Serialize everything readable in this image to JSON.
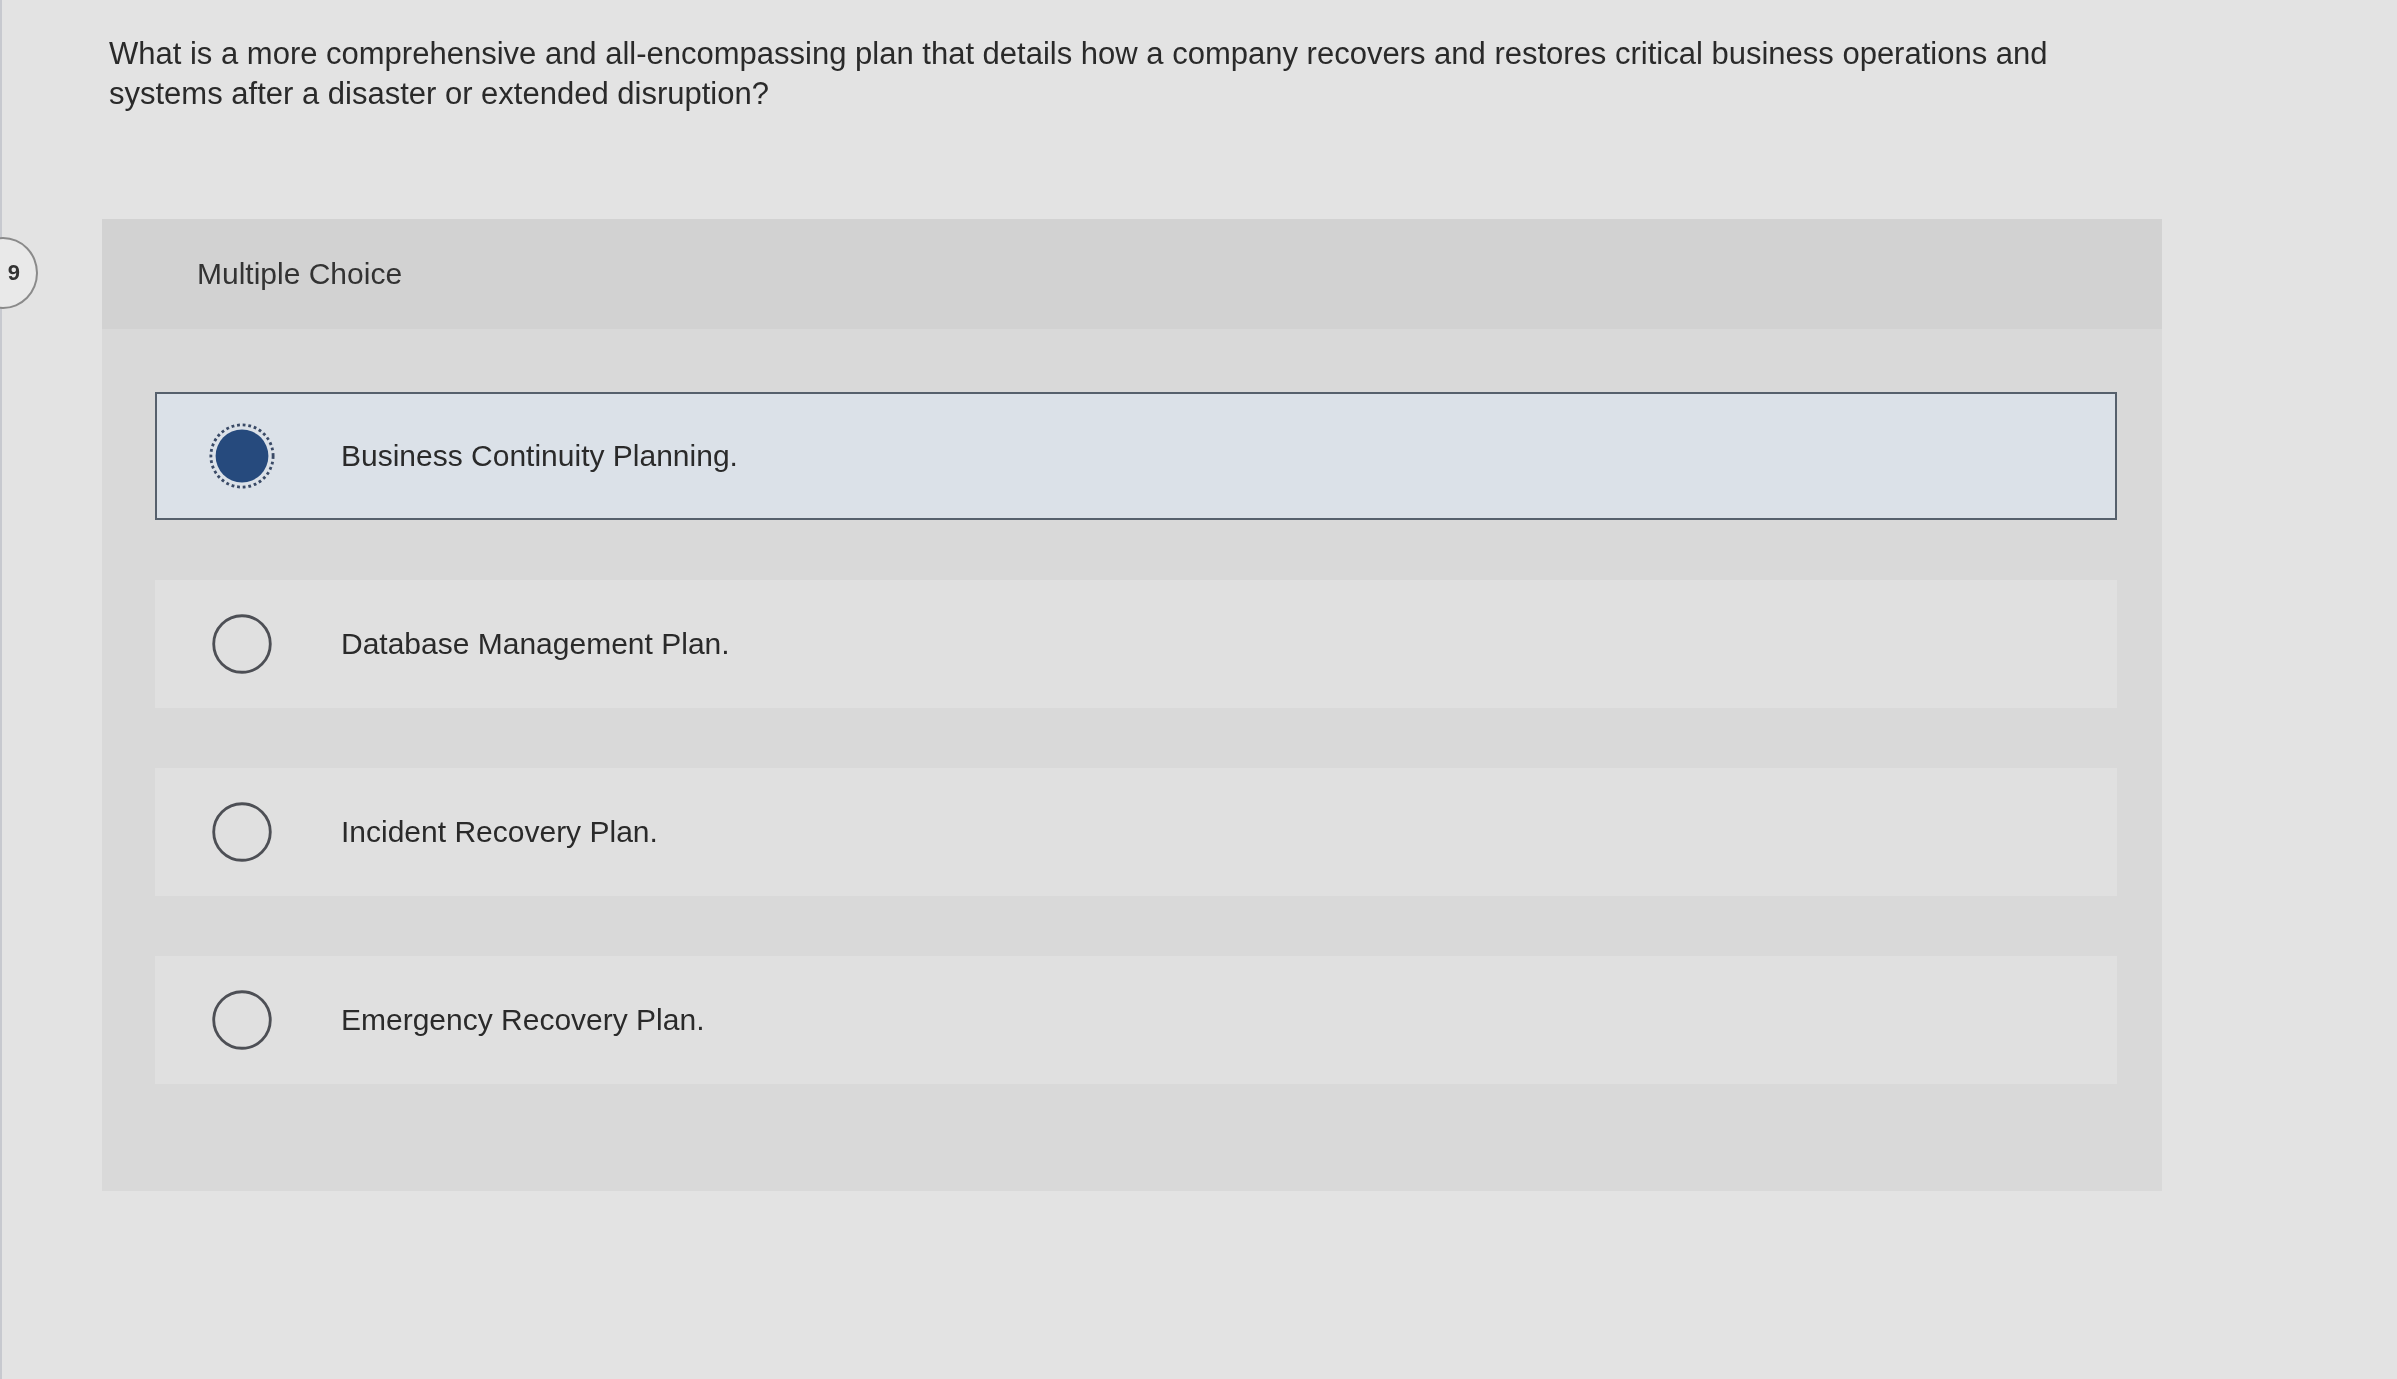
{
  "question_badge": {
    "number": "9"
  },
  "question": {
    "text": "What is a more comprehensive and all-encompassing plan that details how a company recovers and restores critical business operations and systems after a disaster or extended disruption?"
  },
  "answer_panel": {
    "title": "Multiple Choice",
    "options": [
      {
        "label": "Business Continuity Planning.",
        "selected": true
      },
      {
        "label": "Database Management Plan.",
        "selected": false
      },
      {
        "label": "Incident Recovery Plan.",
        "selected": false
      },
      {
        "label": "Emergency Recovery Plan.",
        "selected": false
      }
    ]
  }
}
